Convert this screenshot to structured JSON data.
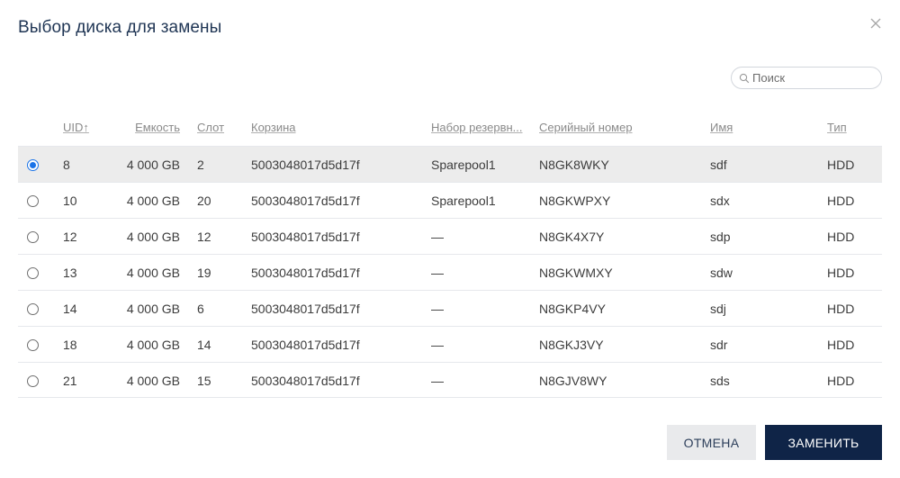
{
  "dialog": {
    "title": "Выбор диска для замены",
    "close_icon": "close-icon"
  },
  "search": {
    "placeholder": "Поиск",
    "value": "",
    "icon": "search-icon"
  },
  "table": {
    "columns": {
      "uid": "UID↑",
      "capacity": "Емкость",
      "slot": "Слот",
      "enclosure": "Корзина",
      "pool": "Набор резервн...",
      "serial": "Серийный номер",
      "name": "Имя",
      "type": "Тип"
    },
    "rows": [
      {
        "selected": true,
        "uid": "8",
        "capacity": "4 000 GB",
        "slot": "2",
        "enclosure": "5003048017d5d17f",
        "pool": "Sparepool1",
        "serial": "N8GK8WKY",
        "name": "sdf",
        "type": "HDD"
      },
      {
        "selected": false,
        "uid": "10",
        "capacity": "4 000 GB",
        "slot": "20",
        "enclosure": "5003048017d5d17f",
        "pool": "Sparepool1",
        "serial": "N8GKWPXY",
        "name": "sdx",
        "type": "HDD"
      },
      {
        "selected": false,
        "uid": "12",
        "capacity": "4 000 GB",
        "slot": "12",
        "enclosure": "5003048017d5d17f",
        "pool": "—",
        "serial": "N8GK4X7Y",
        "name": "sdp",
        "type": "HDD"
      },
      {
        "selected": false,
        "uid": "13",
        "capacity": "4 000 GB",
        "slot": "19",
        "enclosure": "5003048017d5d17f",
        "pool": "—",
        "serial": "N8GKWMXY",
        "name": "sdw",
        "type": "HDD"
      },
      {
        "selected": false,
        "uid": "14",
        "capacity": "4 000 GB",
        "slot": "6",
        "enclosure": "5003048017d5d17f",
        "pool": "—",
        "serial": "N8GKP4VY",
        "name": "sdj",
        "type": "HDD"
      },
      {
        "selected": false,
        "uid": "18",
        "capacity": "4 000 GB",
        "slot": "14",
        "enclosure": "5003048017d5d17f",
        "pool": "—",
        "serial": "N8GKJ3VY",
        "name": "sdr",
        "type": "HDD"
      },
      {
        "selected": false,
        "uid": "21",
        "capacity": "4 000 GB",
        "slot": "15",
        "enclosure": "5003048017d5d17f",
        "pool": "—",
        "serial": "N8GJV8WY",
        "name": "sds",
        "type": "HDD"
      }
    ]
  },
  "buttons": {
    "cancel": "ОТМЕНА",
    "replace": "ЗАМЕНИТЬ"
  },
  "colors": {
    "title": "#1f3554",
    "primary_button": "#0f2447",
    "secondary_button": "#e9eaec",
    "selected_row": "#ececec",
    "radio_selected": "#1a73e8"
  }
}
